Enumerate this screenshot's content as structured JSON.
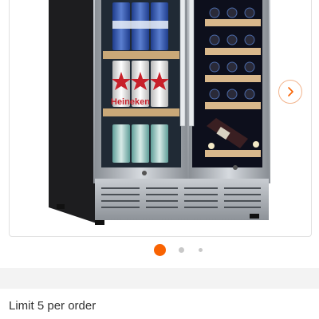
{
  "gallery": {
    "active_dot_color": "#f96302",
    "inactive_dot_color": "#c8c8c8",
    "next_icon": "chevron-right-icon",
    "product_image": "beverage-and-wine-cooler-photo",
    "can_label": "Heineken"
  },
  "order": {
    "limit_text": "Limit 5 per order"
  }
}
